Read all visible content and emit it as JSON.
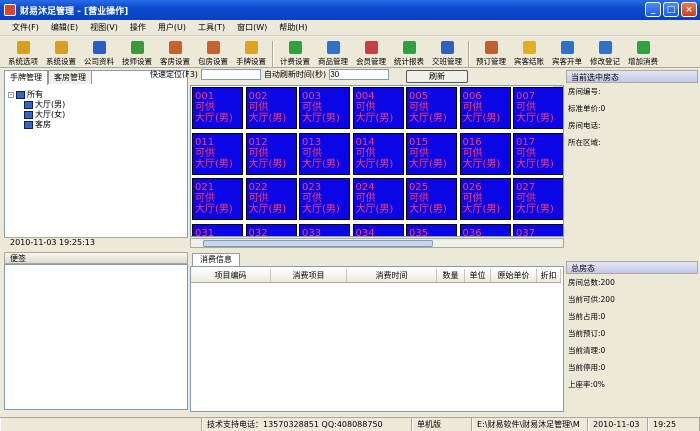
{
  "window": {
    "title": "财易沐足管理 - [营业操作]",
    "min": "_",
    "max": "□",
    "close": "×"
  },
  "menu": [
    "文件(F)",
    "编辑(E)",
    "视图(V)",
    "操作",
    "用户(U)",
    "工具(T)",
    "窗口(W)",
    "帮助(H)"
  ],
  "toolbar": [
    {
      "label": "系统选项",
      "color": "#d8a020"
    },
    {
      "label": "系统设置",
      "color": "#d8a020"
    },
    {
      "label": "公司资料",
      "color": "#2a5cc8"
    },
    {
      "label": "技师设置",
      "color": "#3a9a3a"
    },
    {
      "label": "客房设置",
      "color": "#c86030"
    },
    {
      "label": "包房设置",
      "color": "#c86030"
    },
    {
      "label": "手牌设置",
      "color": "#e0a020"
    },
    {
      "label": "计费设置",
      "color": "#30a040"
    },
    {
      "label": "商品管理",
      "color": "#3070c8"
    },
    {
      "label": "会员管理",
      "color": "#c84040"
    },
    {
      "label": "统计报表",
      "color": "#30a040"
    },
    {
      "label": "交班管理",
      "color": "#3060c0"
    },
    {
      "label": "预订管理",
      "color": "#c06030"
    },
    {
      "label": "宾客结账",
      "color": "#e0b020"
    },
    {
      "label": "宾客开单",
      "color": "#3070c8"
    },
    {
      "label": "修改登记",
      "color": "#3070c8"
    },
    {
      "label": "增加消费",
      "color": "#30a040"
    }
  ],
  "left_tabs": [
    "手牌管理",
    "客房管理"
  ],
  "tree": {
    "root": "所有",
    "children": [
      "大厅(男)",
      "大厅(女)",
      "客房"
    ]
  },
  "quick": {
    "label": "快速定位(F3)",
    "auto_label": "自动刷新时间(秒)",
    "auto_value": "30",
    "refresh": "刷新"
  },
  "datetime": "2010-11-03 19:25:13",
  "memo_title": "便签",
  "rooms": [
    {
      "no": "001",
      "status": "可供",
      "area": "大厅(男)"
    },
    {
      "no": "002",
      "status": "可供",
      "area": "大厅(男)"
    },
    {
      "no": "003",
      "status": "可供",
      "area": "大厅(男)"
    },
    {
      "no": "004",
      "status": "可供",
      "area": "大厅(男)"
    },
    {
      "no": "005",
      "status": "可供",
      "area": "大厅(男)"
    },
    {
      "no": "006",
      "status": "可供",
      "area": "大厅(男)"
    },
    {
      "no": "007",
      "status": "可供",
      "area": "大厅(男)"
    },
    {
      "no": "011",
      "status": "可供",
      "area": "大厅(男)"
    },
    {
      "no": "012",
      "status": "可供",
      "area": "大厅(男)"
    },
    {
      "no": "013",
      "status": "可供",
      "area": "大厅(男)"
    },
    {
      "no": "014",
      "status": "可供",
      "area": "大厅(男)"
    },
    {
      "no": "015",
      "status": "可供",
      "area": "大厅(男)"
    },
    {
      "no": "016",
      "status": "可供",
      "area": "大厅(男)"
    },
    {
      "no": "017",
      "status": "可供",
      "area": "大厅(男)"
    },
    {
      "no": "021",
      "status": "可供",
      "area": "大厅(男)"
    },
    {
      "no": "022",
      "status": "可供",
      "area": "大厅(男)"
    },
    {
      "no": "023",
      "status": "可供",
      "area": "大厅(男)"
    },
    {
      "no": "024",
      "status": "可供",
      "area": "大厅(男)"
    },
    {
      "no": "025",
      "status": "可供",
      "area": "大厅(男)"
    },
    {
      "no": "026",
      "status": "可供",
      "area": "大厅(男)"
    },
    {
      "no": "027",
      "status": "可供",
      "area": "大厅(男)"
    },
    {
      "no": "031",
      "status": "",
      "area": ""
    },
    {
      "no": "032",
      "status": "",
      "area": ""
    },
    {
      "no": "033",
      "status": "",
      "area": ""
    },
    {
      "no": "034",
      "status": "",
      "area": ""
    },
    {
      "no": "035",
      "status": "",
      "area": ""
    },
    {
      "no": "036",
      "status": "",
      "area": ""
    },
    {
      "no": "037",
      "status": "",
      "area": ""
    }
  ],
  "consume_tab": "消费信息",
  "columns": [
    "项目编码",
    "消费项目",
    "消费时间",
    "数量",
    "单位",
    "原始单价",
    "折扣"
  ],
  "room_panel": {
    "title": "当前选中房态",
    "items": [
      "房间编号:",
      "标准单价:0",
      "房间电话:",
      "所在区域:"
    ]
  },
  "total_panel": {
    "title": "总房态",
    "items": [
      "房间总数:200",
      "当前可供:200",
      "当前占用:0",
      "当前预订:0",
      "当前清理:0",
      "当前停用:0",
      "上座率:0%"
    ]
  },
  "status": [
    "",
    "技术支持电话：13570328851 QQ:408088750",
    "单机版",
    "E:\\财易软件\\财易沐足管理\\M",
    "2010-11-03",
    "19:25"
  ],
  "colors": {
    "room_bg": "#0a06e6",
    "room_text": "#ff3a6a",
    "title_bar": "#0a4bd0"
  }
}
